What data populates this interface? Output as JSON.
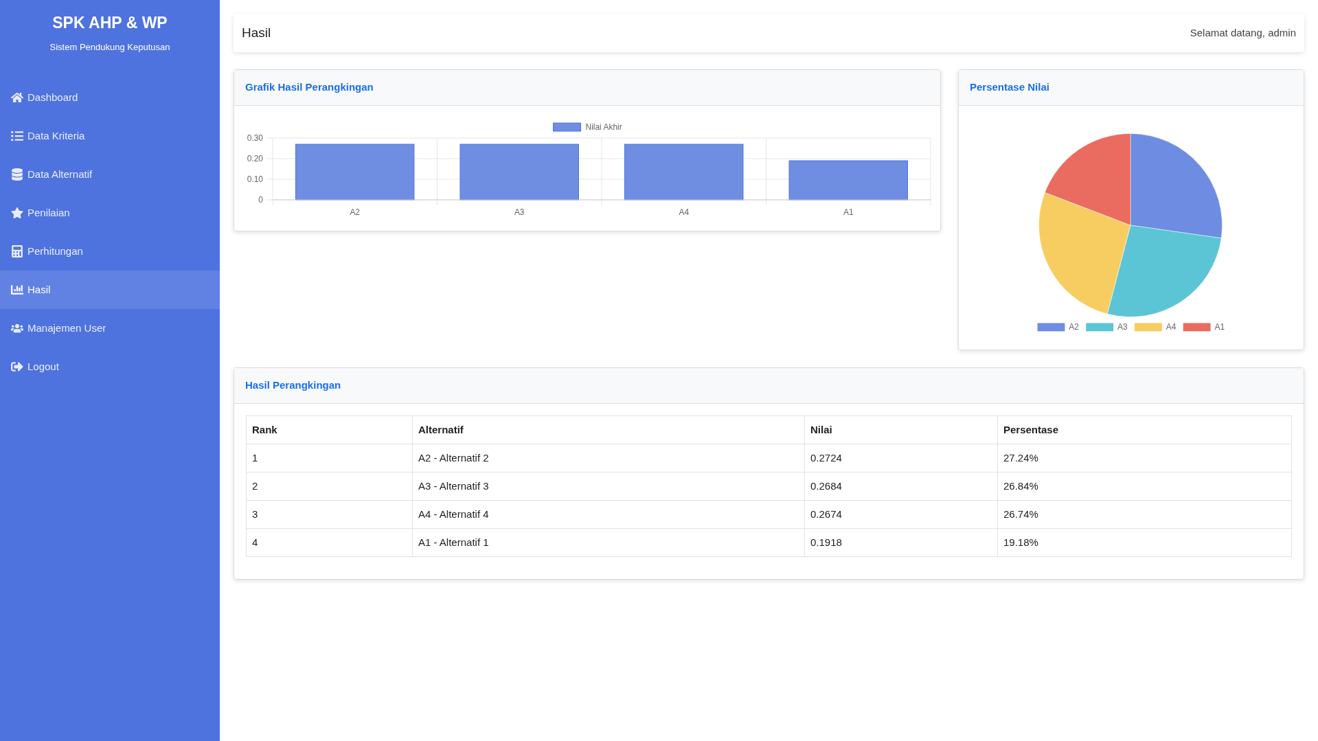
{
  "sidebar": {
    "title": "SPK AHP & WP",
    "subtitle": "Sistem Pendukung Keputusan",
    "items": [
      {
        "label": "Dashboard",
        "selected": false
      },
      {
        "label": "Data Kriteria",
        "selected": false
      },
      {
        "label": "Data Alternatif",
        "selected": false
      },
      {
        "label": "Penilaian",
        "selected": false
      },
      {
        "label": "Perhitungan",
        "selected": false
      },
      {
        "label": "Hasil",
        "selected": true
      },
      {
        "label": "Manajemen User",
        "selected": false
      },
      {
        "label": "Logout",
        "selected": false
      }
    ]
  },
  "header": {
    "title": "Hasil",
    "greeting": "Selamat datang, admin"
  },
  "bar_card": {
    "title": "Grafik Hasil Perangkingan",
    "chart_data": {
      "type": "bar",
      "categories": [
        "A2",
        "A3",
        "A4",
        "A1"
      ],
      "series": [
        {
          "name": "Nilai Akhir",
          "color": "#6f8ee2",
          "values": [
            0.27,
            0.27,
            0.27,
            0.19
          ]
        }
      ],
      "legend": "top",
      "ylim": [
        0,
        0.3
      ],
      "yticks": [
        0,
        {
          "value": 0.1,
          "label": "0.10"
        },
        {
          "value": 0.2,
          "label": "0.20"
        },
        {
          "value": 0.3,
          "label": "0.30"
        }
      ]
    }
  },
  "pie_card": {
    "title": "Persentase Nilai",
    "chart_data": {
      "type": "pie",
      "categories": [
        "A2",
        "A3",
        "A4",
        "A1"
      ],
      "values": [
        0.2724,
        0.2684,
        0.2674,
        0.1918
      ],
      "colors": [
        "#6e8ce2",
        "#5bc5d5",
        "#f7cd62",
        "#ea6b5f"
      ],
      "legend": "bottom"
    }
  },
  "table_card": {
    "title": "Hasil Perangkingan",
    "columns": [
      "Rank",
      "Alternatif",
      "Nilai",
      "Persentase"
    ],
    "rows": [
      [
        "1",
        "A2 - Alternatif 2",
        "0.2724",
        "27.24%"
      ],
      [
        "2",
        "A3 - Alternatif 3",
        "0.2684",
        "26.84%"
      ],
      [
        "3",
        "A4 - Alternatif 4",
        "0.2674",
        "26.74%"
      ],
      [
        "4",
        "A1 - Alternatif 1",
        "0.1918",
        "19.18%"
      ]
    ]
  }
}
